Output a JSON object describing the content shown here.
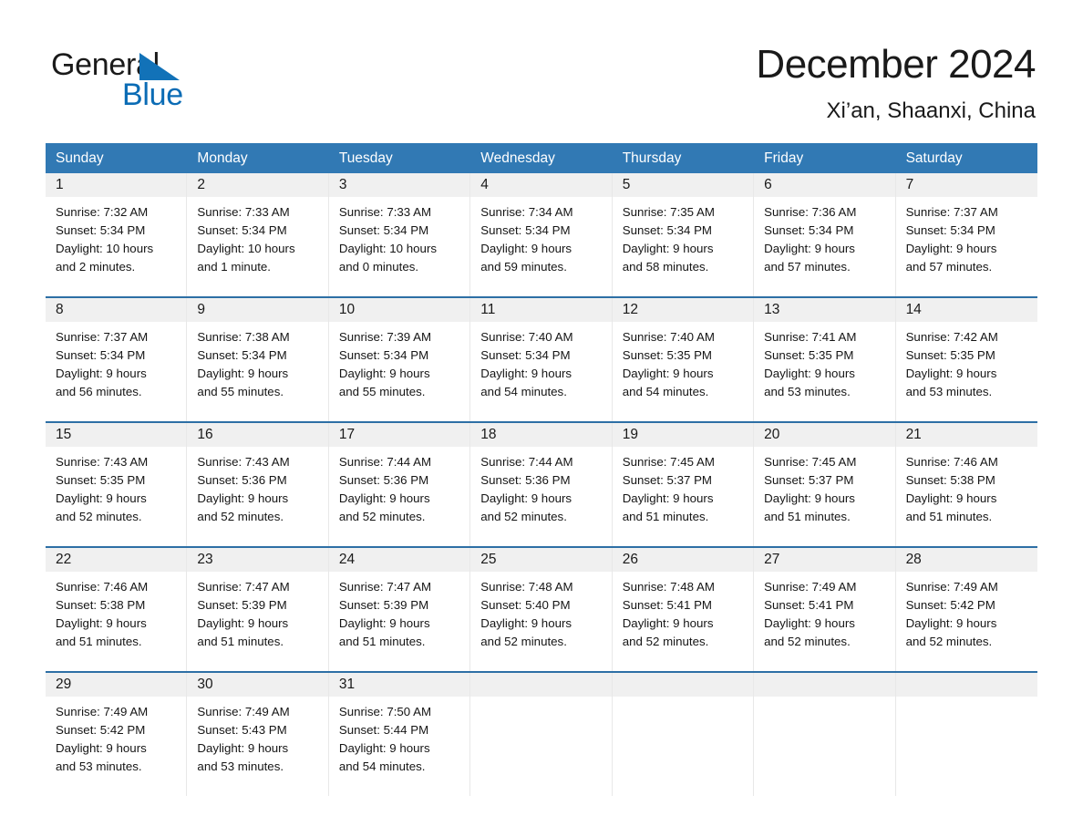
{
  "brand": {
    "name_part1": "General",
    "name_part2": "Blue",
    "triangle_color": "#1272b8",
    "text_color": "#1a1a1a",
    "blue_color": "#0b6cb5"
  },
  "header": {
    "title": "December 2024",
    "location": "Xi’an, Shaanxi, China",
    "header_bg": "#3179b4",
    "row_divider": "#2d6fa5",
    "daynum_band": "#f0f0f0"
  },
  "weekdays": [
    "Sunday",
    "Monday",
    "Tuesday",
    "Wednesday",
    "Thursday",
    "Friday",
    "Saturday"
  ],
  "weeks": [
    {
      "days": [
        {
          "num": "1",
          "sunrise": "Sunrise: 7:32 AM",
          "sunset": "Sunset: 5:34 PM",
          "daylight1": "Daylight: 10 hours",
          "daylight2": "and 2 minutes."
        },
        {
          "num": "2",
          "sunrise": "Sunrise: 7:33 AM",
          "sunset": "Sunset: 5:34 PM",
          "daylight1": "Daylight: 10 hours",
          "daylight2": "and 1 minute."
        },
        {
          "num": "3",
          "sunrise": "Sunrise: 7:33 AM",
          "sunset": "Sunset: 5:34 PM",
          "daylight1": "Daylight: 10 hours",
          "daylight2": "and 0 minutes."
        },
        {
          "num": "4",
          "sunrise": "Sunrise: 7:34 AM",
          "sunset": "Sunset: 5:34 PM",
          "daylight1": "Daylight: 9 hours",
          "daylight2": "and 59 minutes."
        },
        {
          "num": "5",
          "sunrise": "Sunrise: 7:35 AM",
          "sunset": "Sunset: 5:34 PM",
          "daylight1": "Daylight: 9 hours",
          "daylight2": "and 58 minutes."
        },
        {
          "num": "6",
          "sunrise": "Sunrise: 7:36 AM",
          "sunset": "Sunset: 5:34 PM",
          "daylight1": "Daylight: 9 hours",
          "daylight2": "and 57 minutes."
        },
        {
          "num": "7",
          "sunrise": "Sunrise: 7:37 AM",
          "sunset": "Sunset: 5:34 PM",
          "daylight1": "Daylight: 9 hours",
          "daylight2": "and 57 minutes."
        }
      ]
    },
    {
      "days": [
        {
          "num": "8",
          "sunrise": "Sunrise: 7:37 AM",
          "sunset": "Sunset: 5:34 PM",
          "daylight1": "Daylight: 9 hours",
          "daylight2": "and 56 minutes."
        },
        {
          "num": "9",
          "sunrise": "Sunrise: 7:38 AM",
          "sunset": "Sunset: 5:34 PM",
          "daylight1": "Daylight: 9 hours",
          "daylight2": "and 55 minutes."
        },
        {
          "num": "10",
          "sunrise": "Sunrise: 7:39 AM",
          "sunset": "Sunset: 5:34 PM",
          "daylight1": "Daylight: 9 hours",
          "daylight2": "and 55 minutes."
        },
        {
          "num": "11",
          "sunrise": "Sunrise: 7:40 AM",
          "sunset": "Sunset: 5:34 PM",
          "daylight1": "Daylight: 9 hours",
          "daylight2": "and 54 minutes."
        },
        {
          "num": "12",
          "sunrise": "Sunrise: 7:40 AM",
          "sunset": "Sunset: 5:35 PM",
          "daylight1": "Daylight: 9 hours",
          "daylight2": "and 54 minutes."
        },
        {
          "num": "13",
          "sunrise": "Sunrise: 7:41 AM",
          "sunset": "Sunset: 5:35 PM",
          "daylight1": "Daylight: 9 hours",
          "daylight2": "and 53 minutes."
        },
        {
          "num": "14",
          "sunrise": "Sunrise: 7:42 AM",
          "sunset": "Sunset: 5:35 PM",
          "daylight1": "Daylight: 9 hours",
          "daylight2": "and 53 minutes."
        }
      ]
    },
    {
      "days": [
        {
          "num": "15",
          "sunrise": "Sunrise: 7:43 AM",
          "sunset": "Sunset: 5:35 PM",
          "daylight1": "Daylight: 9 hours",
          "daylight2": "and 52 minutes."
        },
        {
          "num": "16",
          "sunrise": "Sunrise: 7:43 AM",
          "sunset": "Sunset: 5:36 PM",
          "daylight1": "Daylight: 9 hours",
          "daylight2": "and 52 minutes."
        },
        {
          "num": "17",
          "sunrise": "Sunrise: 7:44 AM",
          "sunset": "Sunset: 5:36 PM",
          "daylight1": "Daylight: 9 hours",
          "daylight2": "and 52 minutes."
        },
        {
          "num": "18",
          "sunrise": "Sunrise: 7:44 AM",
          "sunset": "Sunset: 5:36 PM",
          "daylight1": "Daylight: 9 hours",
          "daylight2": "and 52 minutes."
        },
        {
          "num": "19",
          "sunrise": "Sunrise: 7:45 AM",
          "sunset": "Sunset: 5:37 PM",
          "daylight1": "Daylight: 9 hours",
          "daylight2": "and 51 minutes."
        },
        {
          "num": "20",
          "sunrise": "Sunrise: 7:45 AM",
          "sunset": "Sunset: 5:37 PM",
          "daylight1": "Daylight: 9 hours",
          "daylight2": "and 51 minutes."
        },
        {
          "num": "21",
          "sunrise": "Sunrise: 7:46 AM",
          "sunset": "Sunset: 5:38 PM",
          "daylight1": "Daylight: 9 hours",
          "daylight2": "and 51 minutes."
        }
      ]
    },
    {
      "days": [
        {
          "num": "22",
          "sunrise": "Sunrise: 7:46 AM",
          "sunset": "Sunset: 5:38 PM",
          "daylight1": "Daylight: 9 hours",
          "daylight2": "and 51 minutes."
        },
        {
          "num": "23",
          "sunrise": "Sunrise: 7:47 AM",
          "sunset": "Sunset: 5:39 PM",
          "daylight1": "Daylight: 9 hours",
          "daylight2": "and 51 minutes."
        },
        {
          "num": "24",
          "sunrise": "Sunrise: 7:47 AM",
          "sunset": "Sunset: 5:39 PM",
          "daylight1": "Daylight: 9 hours",
          "daylight2": "and 51 minutes."
        },
        {
          "num": "25",
          "sunrise": "Sunrise: 7:48 AM",
          "sunset": "Sunset: 5:40 PM",
          "daylight1": "Daylight: 9 hours",
          "daylight2": "and 52 minutes."
        },
        {
          "num": "26",
          "sunrise": "Sunrise: 7:48 AM",
          "sunset": "Sunset: 5:41 PM",
          "daylight1": "Daylight: 9 hours",
          "daylight2": "and 52 minutes."
        },
        {
          "num": "27",
          "sunrise": "Sunrise: 7:49 AM",
          "sunset": "Sunset: 5:41 PM",
          "daylight1": "Daylight: 9 hours",
          "daylight2": "and 52 minutes."
        },
        {
          "num": "28",
          "sunrise": "Sunrise: 7:49 AM",
          "sunset": "Sunset: 5:42 PM",
          "daylight1": "Daylight: 9 hours",
          "daylight2": "and 52 minutes."
        }
      ]
    },
    {
      "days": [
        {
          "num": "29",
          "sunrise": "Sunrise: 7:49 AM",
          "sunset": "Sunset: 5:42 PM",
          "daylight1": "Daylight: 9 hours",
          "daylight2": "and 53 minutes."
        },
        {
          "num": "30",
          "sunrise": "Sunrise: 7:49 AM",
          "sunset": "Sunset: 5:43 PM",
          "daylight1": "Daylight: 9 hours",
          "daylight2": "and 53 minutes."
        },
        {
          "num": "31",
          "sunrise": "Sunrise: 7:50 AM",
          "sunset": "Sunset: 5:44 PM",
          "daylight1": "Daylight: 9 hours",
          "daylight2": "and 54 minutes."
        },
        {
          "num": "",
          "sunrise": "",
          "sunset": "",
          "daylight1": "",
          "daylight2": ""
        },
        {
          "num": "",
          "sunrise": "",
          "sunset": "",
          "daylight1": "",
          "daylight2": ""
        },
        {
          "num": "",
          "sunrise": "",
          "sunset": "",
          "daylight1": "",
          "daylight2": ""
        },
        {
          "num": "",
          "sunrise": "",
          "sunset": "",
          "daylight1": "",
          "daylight2": ""
        }
      ]
    }
  ]
}
